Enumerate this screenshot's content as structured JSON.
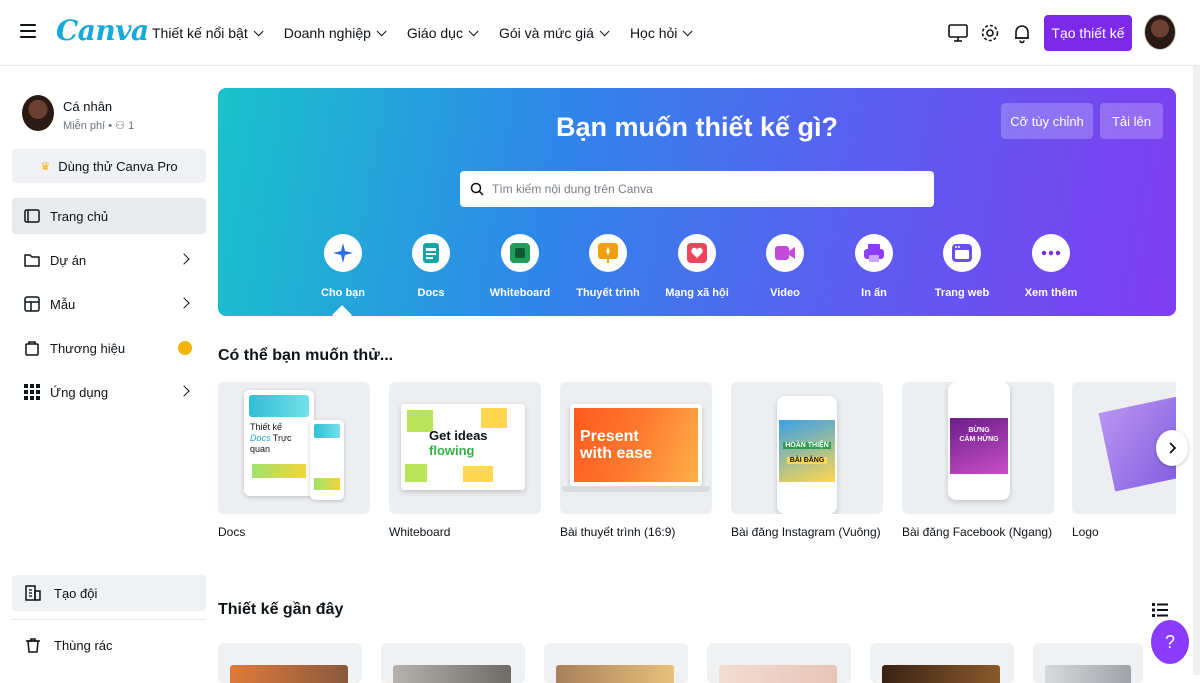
{
  "app": {
    "logo": "Canva"
  },
  "nav": [
    {
      "label": "Thiết kế nổi bật"
    },
    {
      "label": "Doanh nghiệp"
    },
    {
      "label": "Giáo dục"
    },
    {
      "label": "Gói và mức giá"
    },
    {
      "label": "Học hỏi"
    }
  ],
  "header": {
    "create_label": "Tạo thiết kế"
  },
  "sidebar": {
    "profile_name": "Cá nhân",
    "profile_plan": "Miễn phí",
    "profile_members": "1",
    "pro_label": "Dùng thử Canva Pro",
    "items": [
      {
        "label": "Trang chủ"
      },
      {
        "label": "Dự án"
      },
      {
        "label": "Mẫu"
      },
      {
        "label": "Thương hiệu"
      },
      {
        "label": "Ứng dụng"
      }
    ],
    "team_label": "Tạo đội",
    "trash_label": "Thùng rác"
  },
  "hero": {
    "title": "Bạn muốn thiết kế gì?",
    "custom_size_label": "Cỡ tùy chỉnh",
    "upload_label": "Tải lên",
    "search_placeholder": "Tìm kiếm nội dung trên Canva",
    "categories": [
      {
        "label": "Cho bạn",
        "icon": "sparkle-icon",
        "color": "#2b6de8"
      },
      {
        "label": "Docs",
        "icon": "docs-icon",
        "color": "#13a5a9"
      },
      {
        "label": "Whiteboard",
        "icon": "whiteboard-icon",
        "color": "#1e9e5a"
      },
      {
        "label": "Thuyết trình",
        "icon": "presentation-icon",
        "color": "#f59e0b"
      },
      {
        "label": "Mạng xã hội",
        "icon": "heart-icon",
        "color": "#f0445a"
      },
      {
        "label": "Video",
        "icon": "video-icon",
        "color": "#c44bd9"
      },
      {
        "label": "In ấn",
        "icon": "printer-icon",
        "color": "#8b3dff"
      },
      {
        "label": "Trang web",
        "icon": "website-icon",
        "color": "#6a4ff0"
      },
      {
        "label": "Xem thêm",
        "icon": "more-icon",
        "color": "#7d2ae8"
      }
    ]
  },
  "suggestions": {
    "title": "Có thể bạn muốn thử...",
    "cards": [
      {
        "label": "Docs",
        "thumb_lines": [
          "Thiết kế",
          "Docs",
          "Trực quan"
        ]
      },
      {
        "label": "Whiteboard",
        "thumb_lines": [
          "Get ideas",
          "flowing"
        ]
      },
      {
        "label": "Bài thuyết trình (16:9)",
        "thumb_lines": [
          "Present",
          "with ease"
        ]
      },
      {
        "label": "Bài đăng Instagram (Vuông)",
        "thumb_lines": [
          "HOÀN THIỆN",
          "BÀI ĐĂNG"
        ]
      },
      {
        "label": "Bài đăng Facebook (Ngang)",
        "thumb_lines": [
          "BỪNG",
          "CẢM HỨNG"
        ]
      },
      {
        "label": "Logo",
        "thumb_lines": []
      }
    ]
  },
  "recent": {
    "title": "Thiết kế gần đây"
  }
}
